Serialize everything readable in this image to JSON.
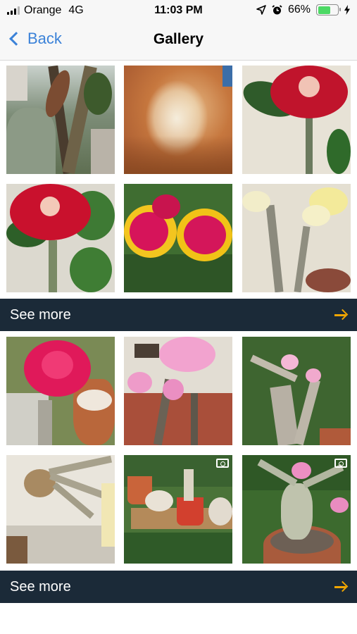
{
  "status_bar": {
    "carrier": "Orange",
    "network": "4G",
    "time": "11:03 PM",
    "battery_percent": "66%",
    "battery_level": 0.66,
    "icons": [
      "signal-icon",
      "location-arrow-icon",
      "alarm-icon",
      "battery-icon",
      "charging-bolt-icon"
    ]
  },
  "nav": {
    "back_label": "Back",
    "title": "Gallery",
    "accent_color": "#3b82d8"
  },
  "sections": [
    {
      "photos": [
        {
          "name": "photo-plant-stems"
        },
        {
          "name": "photo-seed-fluff"
        },
        {
          "name": "photo-red-flower"
        },
        {
          "name": "photo-red-flower-leaves"
        },
        {
          "name": "photo-red-yellow-flowers"
        },
        {
          "name": "photo-white-yellow-flowers"
        }
      ],
      "see_more_label": "See more"
    },
    {
      "photos": [
        {
          "name": "photo-pink-double-flower"
        },
        {
          "name": "photo-pink-flowers-patio"
        },
        {
          "name": "photo-pink-flower-plant"
        },
        {
          "name": "photo-bare-caudex"
        },
        {
          "name": "photo-potted-seedlings",
          "video": true
        },
        {
          "name": "photo-caudex-pink-blooms",
          "video": true
        }
      ],
      "see_more_label": "See more"
    }
  ],
  "colors": {
    "bar_background": "#1b2a38",
    "arrow": "#f0a500",
    "battery_fill": "#4cd964"
  }
}
